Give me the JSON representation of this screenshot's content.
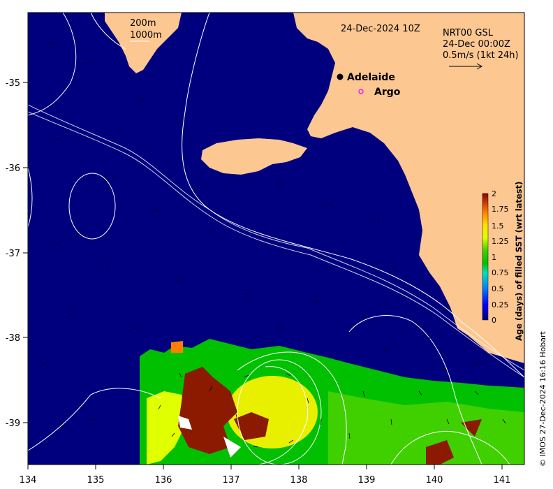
{
  "map": {
    "date_label": "24-Dec-2024 10Z",
    "current_source": "NRT00 GSL",
    "current_time": "24-Dec 00:00Z",
    "current_scale": "0.5m/s (1kt 24h)",
    "isobath_labels": [
      "200m",
      "1000m"
    ],
    "credit": "© IMOS 27-Dec-2024 16:16 Hobart",
    "colors": {
      "ocean": "#00007f",
      "land": "#fdc792",
      "contour": "#ffffff"
    }
  },
  "axes": {
    "x_ticks": [
      "134",
      "135",
      "136",
      "137",
      "138",
      "139",
      "140",
      "141"
    ],
    "y_ticks": [
      "-35",
      "-36",
      "-37",
      "-38",
      "-39"
    ]
  },
  "places": [
    {
      "name": "Adelaide",
      "marker": "filled-circle",
      "color": "#000000"
    },
    {
      "name": "Argo",
      "marker": "open-circle",
      "color": "#ff00ff"
    }
  ],
  "colorbar": {
    "title": "Age (days) of filled SST (wrt latest)",
    "ticks": [
      "2",
      "1.75",
      "1.5",
      "1.25",
      "1",
      "0.75",
      "0.5",
      "0.25",
      "0"
    ]
  }
}
